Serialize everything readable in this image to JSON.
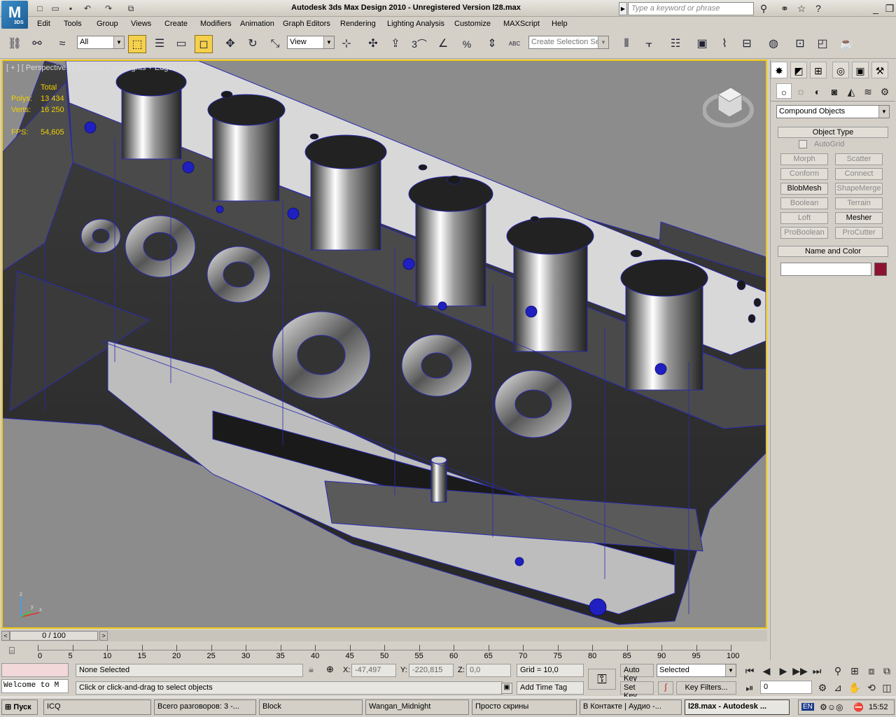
{
  "window": {
    "title": "Autodesk 3ds Max Design 2010 - Unregistered Version     l28.max",
    "logo": "M",
    "logo_sub": "3DS",
    "search_placeholder": "Type a keyword or phrase"
  },
  "menu": [
    "Edit",
    "Tools",
    "Group",
    "Views",
    "Create",
    "Modifiers",
    "Animation",
    "Graph Editors",
    "Rendering",
    "Lighting Analysis",
    "Customize",
    "MAXScript",
    "Help"
  ],
  "toolbar": {
    "selection_filter": "All",
    "reference_coord": "View",
    "named_selection_placeholder": "Create Selection Se",
    "snap_3": "3",
    "percent": "%",
    "abc": "ABC"
  },
  "viewport": {
    "label": "[ + ] [ Perspective ] [ Smooth + Highlights + Edged Faces ]",
    "stats": {
      "total_label": "Total",
      "polys_label": "Polys:",
      "polys_value": "13 434",
      "verts_label": "Verts:",
      "verts_value": "16 250",
      "fps_label": "FPS:",
      "fps_value": "54,605"
    }
  },
  "command_panel": {
    "category": "Compound Objects",
    "object_type_title": "Object Type",
    "autogrid": "AutoGrid",
    "buttons": [
      {
        "label": "Morph",
        "enabled": false
      },
      {
        "label": "Scatter",
        "enabled": false
      },
      {
        "label": "Conform",
        "enabled": false
      },
      {
        "label": "Connect",
        "enabled": false
      },
      {
        "label": "BlobMesh",
        "enabled": true
      },
      {
        "label": "ShapeMerge",
        "enabled": false
      },
      {
        "label": "Boolean",
        "enabled": false
      },
      {
        "label": "Terrain",
        "enabled": false
      },
      {
        "label": "Loft",
        "enabled": false
      },
      {
        "label": "Mesher",
        "enabled": true
      },
      {
        "label": "ProBoolean",
        "enabled": false
      },
      {
        "label": "ProCutter",
        "enabled": false
      }
    ],
    "name_color_title": "Name and Color",
    "name_value": "",
    "swatch_color": "#8c1430"
  },
  "timeline": {
    "frame": "0 / 100",
    "ticks": [
      "0",
      "5",
      "10",
      "15",
      "20",
      "25",
      "30",
      "35",
      "40",
      "45",
      "50",
      "55",
      "60",
      "65",
      "70",
      "75",
      "80",
      "85",
      "90",
      "95",
      "100"
    ]
  },
  "status": {
    "selection": "None Selected",
    "prompt": "Click or click-and-drag to select objects",
    "x_label": "X:",
    "x_value": "-47,497",
    "y_label": "Y:",
    "y_value": "-220,815",
    "z_label": "Z:",
    "z_value": "0,0",
    "grid": "Grid = 10,0",
    "add_time_tag": "Add Time Tag",
    "auto_key": "Auto Key",
    "set_key": "Set Key",
    "key_mode": "Selected",
    "key_filters": "Key Filters...",
    "current_frame": "0",
    "maxscript": "Welcome to M"
  },
  "taskbar": {
    "start": "Пуск",
    "items": [
      {
        "label": "ICQ",
        "active": false
      },
      {
        "label": "Всего разговоров: 3 -...",
        "active": false
      },
      {
        "label": "Block",
        "active": false
      },
      {
        "label": "Wangan_Midnight",
        "active": false
      },
      {
        "label": "Просто скрины",
        "active": false
      },
      {
        "label": "В Контакте | Аудио -...",
        "active": false
      },
      {
        "label": "l28.max - Autodesk ...",
        "active": true
      }
    ],
    "lang": "EN",
    "clock": "15:52"
  },
  "colors": {
    "viewport_border": "#f0c814",
    "stats_text": "#f0d000",
    "wire": "#2a2ab0"
  }
}
